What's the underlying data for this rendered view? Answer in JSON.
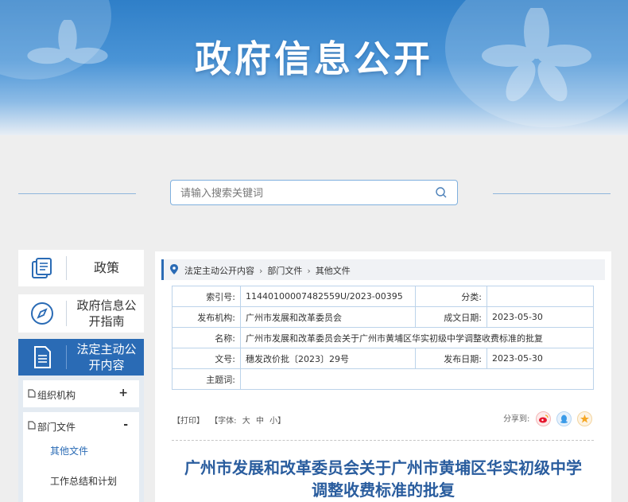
{
  "banner": {
    "title": "政府信息公开"
  },
  "search": {
    "placeholder": "请输入搜索关键词"
  },
  "sidebar": {
    "cards": [
      {
        "label": "政策",
        "icon": "document-stack-icon"
      },
      {
        "label": "政府信息公开指南",
        "icon": "compass-icon"
      },
      {
        "label": "法定主动公开内容",
        "icon": "file-list-icon"
      }
    ],
    "subnav": {
      "org": {
        "label": "组织机构",
        "sign": "+"
      },
      "dept": {
        "label": "部门文件",
        "sign": "-"
      },
      "leaves": [
        "其他文件",
        "工作总结和计划"
      ]
    }
  },
  "breadcrumb": {
    "items": [
      "法定主动公开内容",
      "部门文件",
      "其他文件"
    ]
  },
  "meta": {
    "index_label": "索引号:",
    "index_value": "11440100007482559U/2023-00395",
    "category_label": "分类:",
    "category_value": "",
    "agency_label": "发布机构:",
    "agency_value": "广州市发展和改革委员会",
    "created_label": "成文日期:",
    "created_value": "2023-05-30",
    "name_label": "名称:",
    "name_value": "广州市发展和改革委员会关于广州市黄埔区华实初级中学调整收费标准的批复",
    "docno_label": "文号:",
    "docno_value": "穗发改价批〔2023〕29号",
    "published_label": "发布日期:",
    "published_value": "2023-05-30",
    "subject_label": "主题词:",
    "subject_value": ""
  },
  "tools": {
    "print": "【打印】",
    "font": "【字体:",
    "large": "大",
    "medium": "中",
    "small": "小】"
  },
  "share": {
    "label": "分享到:"
  },
  "document": {
    "title_line1": "广州市发展和改革委员会关于广州市黄埔区华实初级中学",
    "title_line2": "调整收费标准的批复"
  },
  "colors": {
    "accent": "#2a6bb5",
    "title_blue": "#2a5d9e",
    "weibo": "#e6162d",
    "qq": "#3b9be8",
    "star": "#f5a623"
  }
}
